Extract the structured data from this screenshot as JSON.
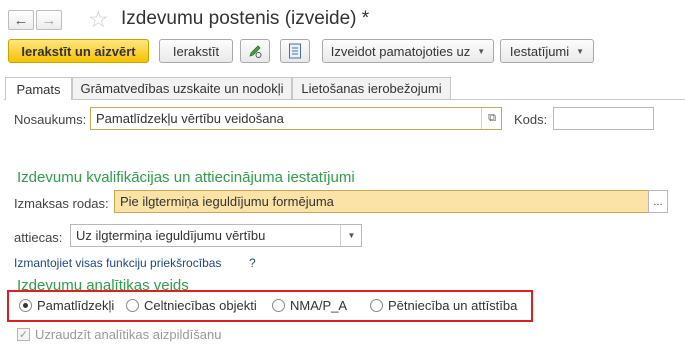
{
  "header": {
    "title": "Izdevumu postenis (izveide) *",
    "back_icon": "arrow-left-icon",
    "forward_icon": "arrow-right-icon",
    "favorite_icon": "star-icon"
  },
  "toolbar": {
    "save_close_label": "Ierakstīt un aizvērt",
    "save_label": "Ierakstīt",
    "create_based_label": "Izveidot pamatojoties uz",
    "settings_label": "Iestatījumi"
  },
  "tabs": [
    {
      "label": "Pamats"
    },
    {
      "label": "Grāmatvedības uzskaite un nodokļi"
    },
    {
      "label": "Lietošanas ierobežojumi"
    }
  ],
  "form": {
    "name_label": "Nosaukums:",
    "name_value": "Pamatlīdzekļu vērtību veidošana",
    "code_label": "Kods:",
    "code_value": ""
  },
  "section1": {
    "title": "Izdevumu kvalifikācijas un attiecinājuma iestatījumi",
    "expense_label": "Izmaksas rodas:",
    "expense_value": "Pie ilgtermiņa ieguldījumu formējuma",
    "relates_label": "attiecas:",
    "relates_value": "Uz ilgtermiņa ieguldījumu vērtību",
    "link_text": "Izmantojiet visas funkciju priekšrocības",
    "help_mark": "?"
  },
  "section2": {
    "title": "Izdevumu analītikas veids",
    "options": [
      {
        "label": "Pamatlīdzekļi",
        "selected": true
      },
      {
        "label": "Celtniecības objekti",
        "selected": false
      },
      {
        "label": "NMA/P_A",
        "selected": false
      },
      {
        "label": "Pētniecība un attīstība",
        "selected": false
      }
    ],
    "checkbox_label": "Uzraudzīt analītikas aizpildīšanu",
    "checkbox_checked": true
  },
  "colors": {
    "accent_yellow": "#f5c200",
    "section_green": "#2e9f47",
    "highlight_red": "#e02020",
    "field_yellow": "#fbe3a7"
  }
}
